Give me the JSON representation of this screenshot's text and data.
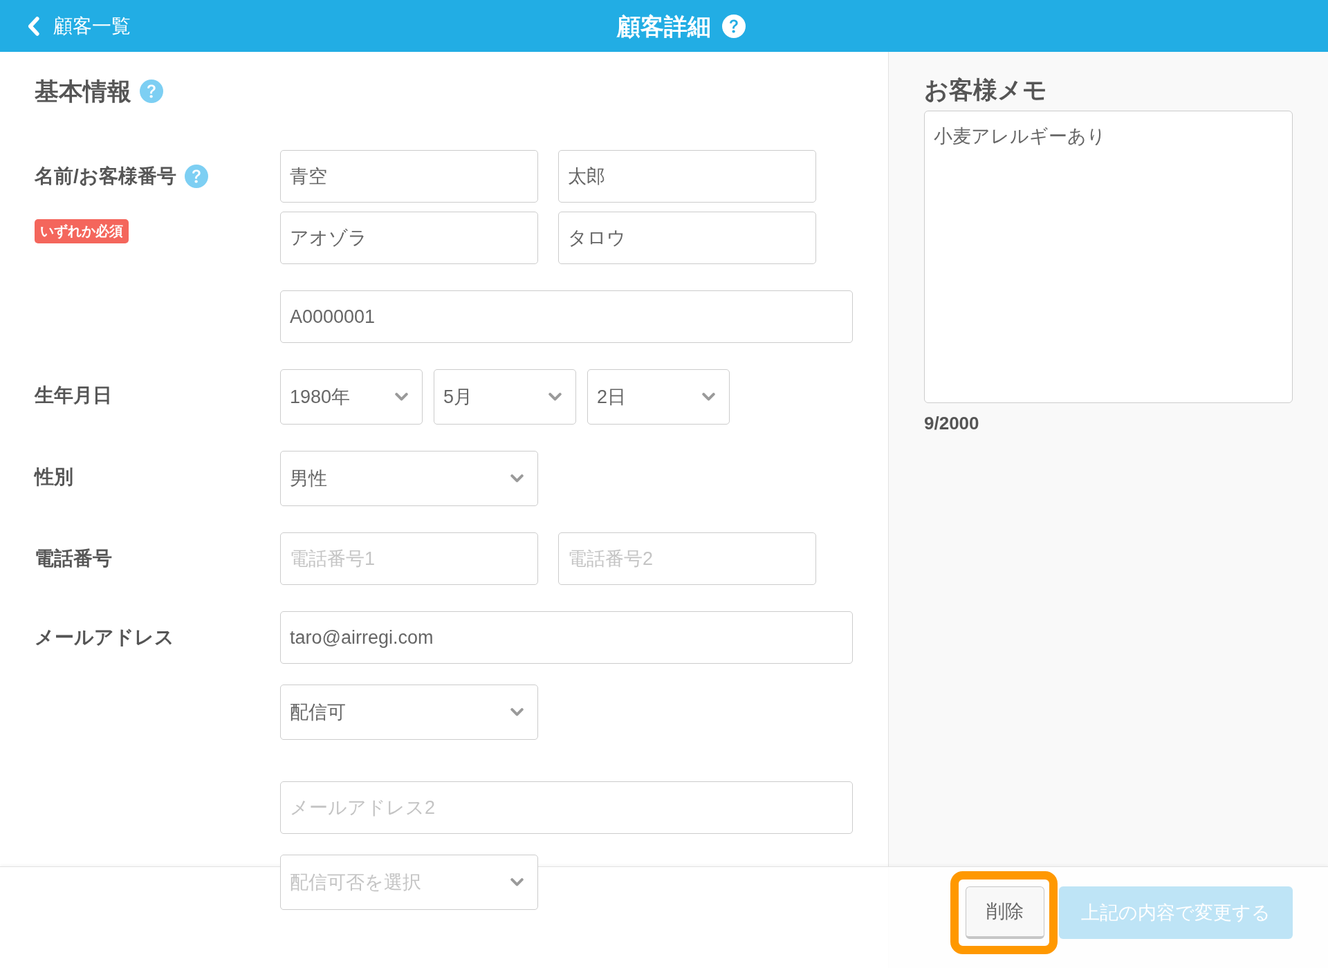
{
  "header": {
    "back": {
      "label": "顧客一覧"
    },
    "title": "顧客詳細",
    "help": true
  },
  "basic_info": {
    "title": "基本情報",
    "help": true,
    "rows": [
      {
        "label": "名前/お客様番号",
        "help": true,
        "badge": "いずれか必須",
        "lines": [
          [
            {
              "kind": "text",
              "value": "青空"
            },
            {
              "kind": "text",
              "value": "太郎"
            }
          ],
          [
            {
              "kind": "text",
              "value": "アオゾラ"
            },
            {
              "kind": "text",
              "value": "タロウ"
            }
          ]
        ]
      },
      {
        "lines": [
          [
            {
              "kind": "wide_text",
              "value": "A0000001"
            }
          ]
        ]
      },
      {
        "label": "生年月日",
        "lines": [
          [
            {
              "kind": "small_select",
              "value": "1980年"
            },
            {
              "kind": "small_select",
              "value": "5月"
            },
            {
              "kind": "small_select",
              "value": "2日"
            }
          ]
        ]
      },
      {
        "label": "性別",
        "lines": [
          [
            {
              "kind": "select",
              "value": "男性"
            }
          ]
        ]
      },
      {
        "label": "電話番号",
        "lines": [
          [
            {
              "kind": "text",
              "placeholder": "電話番号1"
            },
            {
              "kind": "text",
              "placeholder": "電話番号2"
            }
          ]
        ]
      },
      {
        "label": "メールアドレス",
        "lines": [
          [
            {
              "kind": "wide_text",
              "value": "taro@airregi.com"
            }
          ],
          [
            {
              "kind": "select",
              "value": "配信可"
            }
          ]
        ]
      },
      {
        "lines": [
          [
            {
              "kind": "wide_text",
              "placeholder": "メールアドレス2"
            }
          ],
          [
            {
              "kind": "select",
              "placeholder": "配信可否を選択"
            }
          ]
        ]
      }
    ]
  },
  "memo": {
    "title": "お客様メモ",
    "value": "小麦アレルギーあり",
    "counter": "9/2000"
  },
  "footer": {
    "buttons": [
      {
        "kind": "secondary",
        "label": "削除",
        "disabled": false,
        "highlighted": true
      },
      {
        "kind": "primary",
        "label": "上記の内容で変更する",
        "disabled": true,
        "highlighted": false
      }
    ]
  }
}
